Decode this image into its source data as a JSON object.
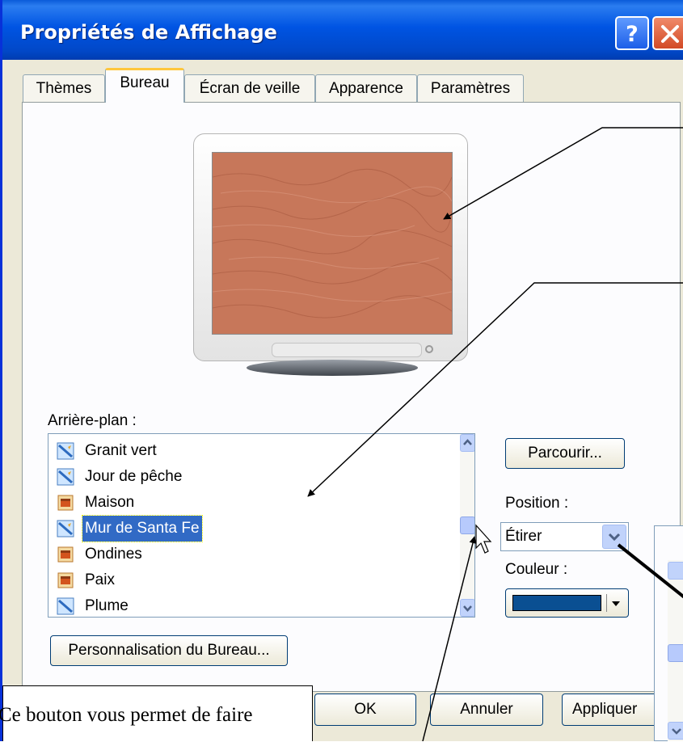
{
  "window": {
    "title": "Propriétés de Affichage",
    "help_label": "?",
    "close_icon": "close-icon"
  },
  "tabs": [
    {
      "label": "Thèmes"
    },
    {
      "label": "Bureau",
      "active": true
    },
    {
      "label": "Écran de veille"
    },
    {
      "label": "Apparence"
    },
    {
      "label": "Paramètres"
    }
  ],
  "background": {
    "label": "Arrière-plan :",
    "items": [
      {
        "label": "Granit vert",
        "icon": "image-file-icon"
      },
      {
        "label": "Jour de pêche",
        "icon": "image-file-icon"
      },
      {
        "label": "Maison",
        "icon": "photo-file-icon"
      },
      {
        "label": "Mur de Santa Fe",
        "icon": "image-file-icon",
        "selected": true
      },
      {
        "label": "Ondines",
        "icon": "photo-file-icon"
      },
      {
        "label": "Paix",
        "icon": "photo-file-icon"
      },
      {
        "label": "Plume",
        "icon": "image-file-icon"
      }
    ]
  },
  "browse_label": "Parcourir...",
  "position": {
    "label": "Position :",
    "value": "Étirer"
  },
  "color": {
    "label": "Couleur :",
    "value": "#0a4f92"
  },
  "customize_label": "Personnalisation du Bureau...",
  "buttons": {
    "ok": "OK",
    "cancel": "Annuler",
    "apply": "Appliquer"
  },
  "callout": {
    "text": "Ce bouton  vous permet de faire"
  },
  "colors": {
    "titlebar": "#0054e3",
    "selection": "#316ac5",
    "tab_highlight": "#ffc73c",
    "wallpaper": "#c7775a"
  }
}
